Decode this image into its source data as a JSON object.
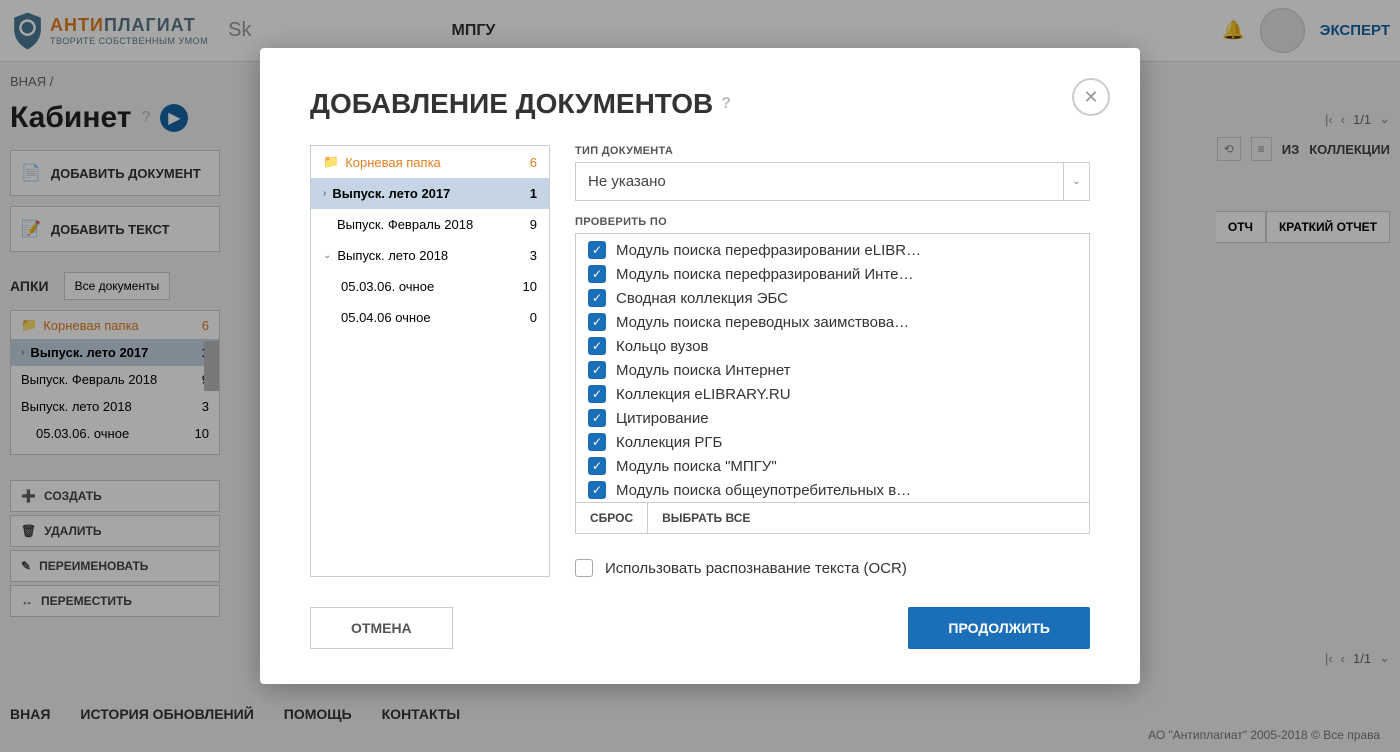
{
  "header": {
    "logo_anti": "АНТИ",
    "logo_plag": "ПЛАГИАТ",
    "logo_sub": "ТВОРИТЕ СОБСТВЕННЫМ УМОМ",
    "sk": "Sk",
    "org": "МПГУ",
    "role": "ЭКСПЕРТ"
  },
  "breadcrumb": "ВНАЯ  /",
  "page_title": "Кабинет",
  "actions": {
    "add_doc": "ДОБАВИТЬ ДОКУМЕНТ",
    "add_text": "ДОБАВИТЬ ТЕКСТ"
  },
  "folders_label": "АПКИ",
  "all_docs": "Все документы",
  "folders": [
    {
      "name": "Корневая папка",
      "count": "6",
      "root": true
    },
    {
      "name": "Выпуск. лето 2017",
      "count": "1",
      "selected": true,
      "chev": "›"
    },
    {
      "name": "Выпуск. Февраль 2018",
      "count": "9"
    },
    {
      "name": "Выпуск. лето 2018",
      "count": "3"
    },
    {
      "name": "05.03.06. очное",
      "count": "10",
      "indent": true
    },
    {
      "name": "05.04.06 очное",
      "count": "0",
      "indent": true
    }
  ],
  "folder_actions": {
    "create": "СОЗДАТЬ",
    "delete": "УДАЛИТЬ",
    "rename": "ПЕРЕИМЕНОВАТЬ",
    "move": "ПЕРЕМЕСТИТЬ"
  },
  "toolbar": {
    "from": "ИЗ",
    "collections": "КОЛЛЕКЦИИ"
  },
  "pagination": {
    "pages": "1/1"
  },
  "report_short": "КРАТКИЙ ОТЧЕТ",
  "report_full": "ОТЧ",
  "counter": "1",
  "footer": {
    "main": "ВНАЯ",
    "history": "ИСТОРИЯ ОБНОВЛЕНИЙ",
    "help": "ПОМОЩЬ",
    "contacts": "КОНТАКТЫ"
  },
  "footer_right": "АО \"Антиплагиат\" 2005-2018 © Все права",
  "modal": {
    "title": "ДОБАВЛЕНИЕ ДОКУМЕНТОВ",
    "folders": [
      {
        "name": "Корневая папка",
        "count": "6",
        "root": true
      },
      {
        "name": "Выпуск. лето 2017",
        "count": "1",
        "selected": true,
        "chev": "›"
      },
      {
        "name": "Выпуск. Февраль 2018",
        "count": "9"
      },
      {
        "name": "Выпуск. лето 2018",
        "count": "3",
        "chev": "⌄"
      },
      {
        "name": "05.03.06. очное",
        "count": "10",
        "indent": true
      },
      {
        "name": "05.04.06 очное",
        "count": "0",
        "indent": true
      }
    ],
    "doctype_label": "ТИП ДОКУМЕНТА",
    "doctype_value": "Не указано",
    "check_label": "ПРОВЕРИТЬ ПО",
    "modules": [
      "Модуль поиска перефразировании eLIBR…",
      "Модуль поиска перефразирований Инте…",
      "Сводная коллекция ЭБС",
      "Модуль поиска переводных заимствова…",
      "Кольцо вузов",
      "Модуль поиска Интернет",
      "Коллекция eLIBRARY.RU",
      "Цитирование",
      "Коллекция РГБ",
      "Модуль поиска \"МПГУ\"",
      "Модуль поиска общеупотребительных в…"
    ],
    "reset": "СБРОС",
    "select_all": "ВЫБРАТЬ ВСЕ",
    "ocr": "Использовать распознавание текста (OCR)",
    "cancel": "ОТМЕНА",
    "continue": "ПРОДОЛЖИТЬ"
  }
}
